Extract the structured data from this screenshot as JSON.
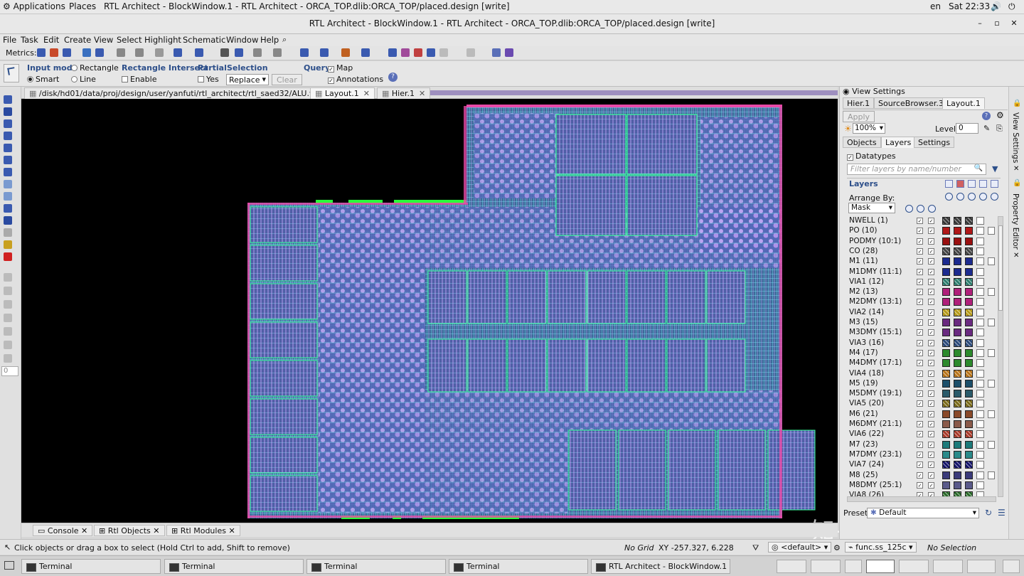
{
  "system": {
    "applications": "Applications",
    "places": "Places",
    "window_title": "RTL Architect - BlockWindow.1 - RTL Architect - ORCA_TOP.dlib:ORCA_TOP/placed.design [write]",
    "lang": "en",
    "clock": "Sat 22:33"
  },
  "window": {
    "title": "RTL Architect - BlockWindow.1 - RTL Architect - ORCA_TOP.dlib:ORCA_TOP/placed.design [write]"
  },
  "menu": [
    "File",
    "Task",
    "Edit",
    "Create",
    "View",
    "Select",
    "Highlight",
    "Schematic",
    "Window",
    "Help"
  ],
  "toolbar": {
    "metrics_label": "Metrics:"
  },
  "modebar": {
    "input_mode": "Input mode",
    "rectangle": "Rectangle",
    "smart": "Smart",
    "line": "Line",
    "rect_intersect": "Rectangle Intersect",
    "enable": "Enable",
    "partial": "Partial",
    "yes": "Yes",
    "selection": "Selection",
    "selection_value": "Replace",
    "clear": "Clear",
    "query": "Query",
    "map": "Map",
    "annotations": "Annotations"
  },
  "tabs": [
    {
      "label": "/disk/hd01/data/proj/design/user/yanfuti/rtl_architect/rtl_saed32/ALU.vhd",
      "active": false
    },
    {
      "label": "Layout.1",
      "active": true
    },
    {
      "label": "Hier.1",
      "active": false
    }
  ],
  "left_tools": {
    "zoom_value": "0"
  },
  "bottom_tabs": [
    "Console",
    "Rtl Objects",
    "Rtl Modules"
  ],
  "status": {
    "hint": "Click objects or drag a box to select (Hold Ctrl to add, Shift to remove)",
    "grid": "No Grid",
    "coords": "XY -257.327, 6.228",
    "default_combo": "<default>",
    "corner": "func.ss_125c",
    "selection": "No Selection"
  },
  "taskbar": [
    {
      "label": "Terminal"
    },
    {
      "label": "Terminal"
    },
    {
      "label": "Terminal"
    },
    {
      "label": "Terminal"
    },
    {
      "label": "RTL Architect - BlockWindow.1 - R..."
    }
  ],
  "view_settings": {
    "title": "View Settings",
    "tabs": [
      "Hier.1",
      "SourceBrowser.3",
      "Layout.1"
    ],
    "apply": "Apply",
    "zoom": "100%",
    "level_label": "Level",
    "level_value": "0",
    "subtabs": [
      "Objects",
      "Layers",
      "Settings"
    ],
    "datatypes": "Datatypes",
    "filter_placeholder": "Filter layers by name/number",
    "layers_heading": "Layers",
    "arrange_by": "Arrange By:",
    "arrange_value": "Mask",
    "preset_label": "Preset",
    "preset_value": "Default",
    "layers": [
      {
        "name": "NWELL (1)",
        "color": "#3a3a3a"
      },
      {
        "name": "PO (10)",
        "color": "#b01818"
      },
      {
        "name": "PODMY (10:1)",
        "color": "#9a1010"
      },
      {
        "name": "CO (28)",
        "color": "#444444"
      },
      {
        "name": "M1 (11)",
        "color": "#1c2b8f"
      },
      {
        "name": "M1DMY (11:1)",
        "color": "#1c2b8f"
      },
      {
        "name": "VIA1 (12)",
        "color": "#2e7d6e"
      },
      {
        "name": "M2 (13)",
        "color": "#b0207a"
      },
      {
        "name": "M2DMY (13:1)",
        "color": "#b0207a"
      },
      {
        "name": "VIA2 (14)",
        "color": "#b59a1a"
      },
      {
        "name": "M3 (15)",
        "color": "#6a2a80"
      },
      {
        "name": "M3DMY (15:1)",
        "color": "#6a2a80"
      },
      {
        "name": "VIA3 (16)",
        "color": "#2c4a7a"
      },
      {
        "name": "M4 (17)",
        "color": "#2d8a2d"
      },
      {
        "name": "M4DMY (17:1)",
        "color": "#2d8a2d"
      },
      {
        "name": "VIA4 (18)",
        "color": "#b8741a"
      },
      {
        "name": "M5 (19)",
        "color": "#1c4f6a"
      },
      {
        "name": "M5DMY (19:1)",
        "color": "#2a5a6a"
      },
      {
        "name": "VIA5 (20)",
        "color": "#7a6a1a"
      },
      {
        "name": "M6 (21)",
        "color": "#8a4a2a"
      },
      {
        "name": "M6DMY (21:1)",
        "color": "#8a5a4a"
      },
      {
        "name": "VIA6 (22)",
        "color": "#a83a2a"
      },
      {
        "name": "M7 (23)",
        "color": "#1c7a7a"
      },
      {
        "name": "M7DMY (23:1)",
        "color": "#2a8a8a"
      },
      {
        "name": "VIA7 (24)",
        "color": "#14146a"
      },
      {
        "name": "M8 (25)",
        "color": "#3a3a7a"
      },
      {
        "name": "M8DMY (25:1)",
        "color": "#5a5a8a"
      },
      {
        "name": "VIA8 (26)",
        "color": "#2a6a2a"
      }
    ]
  },
  "side_vertical": [
    "View Settings",
    "Property Editor"
  ],
  "watermark": "知乎 @阎浮提"
}
